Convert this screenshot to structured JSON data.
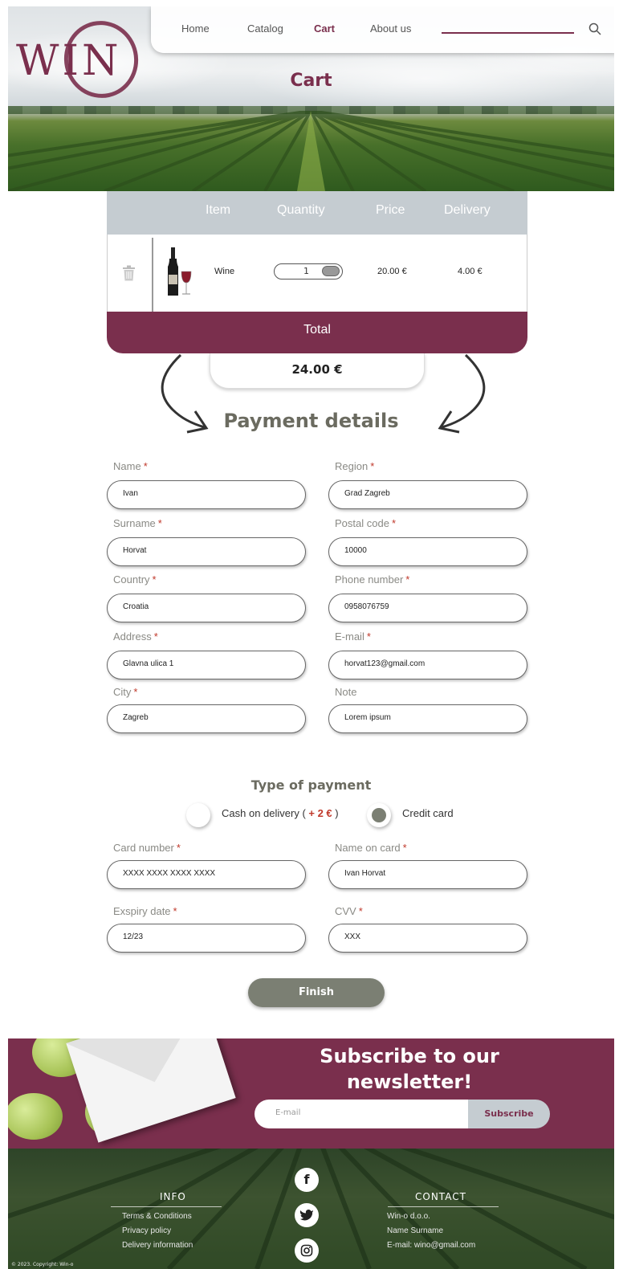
{
  "brand": {
    "logo_text": "WIN"
  },
  "nav": {
    "items": [
      "Home",
      "Catalog",
      "Cart",
      "About us"
    ],
    "active": "Cart"
  },
  "page_title": "Cart",
  "cart": {
    "headers": {
      "item": "Item",
      "quantity": "Quantity",
      "price": "Price",
      "delivery": "Delivery"
    },
    "row": {
      "name": "Wine",
      "quantity": "1",
      "price": "20.00 €",
      "delivery": "4.00 €"
    },
    "total_label": "Total",
    "total_value": "24.00 €"
  },
  "payment": {
    "title": "Payment details",
    "fields": {
      "name": {
        "label": "Name",
        "value": "Ivan"
      },
      "region": {
        "label": "Region",
        "value": "Grad Zagreb"
      },
      "surname": {
        "label": "Surname",
        "value": "Horvat"
      },
      "postal": {
        "label": "Postal code",
        "value": "10000"
      },
      "country": {
        "label": "Country",
        "value": "Croatia"
      },
      "phone": {
        "label": "Phone number",
        "value": "0958076759"
      },
      "address": {
        "label": "Address",
        "value": "Glavna ulica 1"
      },
      "email": {
        "label": "E-mail",
        "value": "horvat123@gmail.com"
      },
      "city": {
        "label": "City",
        "value": "Zagreb"
      },
      "note": {
        "label": "Note",
        "value": "Lorem ipsum"
      }
    },
    "type_title": "Type of payment",
    "cash_label": "Cash on delivery ( ",
    "cash_extra": "+ 2 €",
    "cash_close": " )",
    "card_label": "Credit card",
    "selected": "Credit card",
    "card": {
      "number": {
        "label": "Card number",
        "value": "XXXX XXXX XXXX XXXX"
      },
      "name": {
        "label": "Name on card",
        "value": "Ivan Horvat"
      },
      "expiry": {
        "label": "Exspiry date",
        "value": "12/23"
      },
      "cvv": {
        "label": "CVV",
        "value": "XXX"
      }
    },
    "finish_label": "Finish"
  },
  "newsletter": {
    "title_line1": "Subscribe to our",
    "title_line2": "newsletter!",
    "email_placeholder": "E-mail",
    "button_label": "Subscribe"
  },
  "footer": {
    "info_title": "INFO",
    "info_links": [
      "Terms & Conditions",
      "Privacy policy",
      "Delivery information"
    ],
    "contact_title": "CONTACT",
    "contact_lines": [
      "Win-o d.o.o.",
      "Name Surname",
      "E-mail: wino@gmail.com"
    ],
    "social": [
      "facebook-icon",
      "twitter-icon",
      "instagram-icon"
    ],
    "copyright": "© 2023. Copyright: Win-o"
  },
  "colors": {
    "brand": "#7a2f4d",
    "accent_grey": "#7b7f73",
    "header_grey": "#c5ccd1",
    "required": "#c0392b"
  }
}
